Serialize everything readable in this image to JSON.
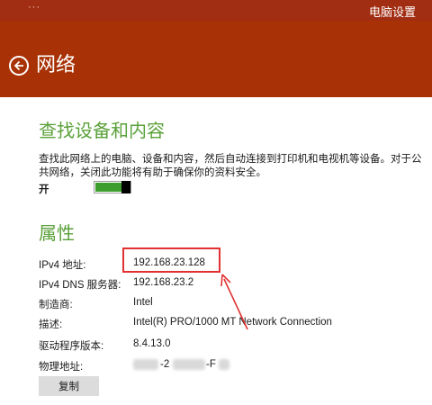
{
  "window": {
    "menu_dots": "···",
    "app_title": "电脑设置"
  },
  "header": {
    "title": "网络"
  },
  "discover": {
    "heading": "查找设备和内容",
    "description": "查找此网络上的电脑、设备和内容，然后自动连接到打印机和电视机等设备。对于公共网络，关闭此功能将有助于确保你的资料安全。",
    "toggle_label": "开",
    "toggle_state": "on"
  },
  "properties": {
    "heading": "属性",
    "rows": [
      {
        "label": "IPv4 地址:",
        "value": "192.168.23.128"
      },
      {
        "label": "IPv4 DNS 服务器:",
        "value": "192.168.23.2"
      },
      {
        "label": "制造商:",
        "value": "Intel"
      },
      {
        "label": "描述:",
        "value": "Intel(R) PRO/1000 MT Network Connection"
      },
      {
        "label": "驱动程序版本:",
        "value": "8.4.13.0"
      },
      {
        "label": "物理地址:",
        "value_part1": "-2",
        "value_part2": "-F"
      }
    ],
    "copy_label": "复制"
  },
  "colors": {
    "header_bg": "#a83206",
    "accent_green": "#5aa13a",
    "annotation_red": "#e03030"
  }
}
